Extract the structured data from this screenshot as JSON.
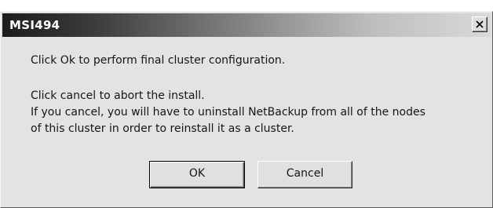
{
  "window": {
    "title": "MSI494",
    "close_icon": "close-x-icon"
  },
  "message": {
    "line1": "Click Ok to perform final cluster configuration.",
    "line2": "Click cancel to abort the install.",
    "line3": "If you cancel, you will have to uninstall NetBackup from all of the nodes",
    "line4": "of this cluster in order to reinstall it as a cluster."
  },
  "buttons": {
    "ok_label": "OK",
    "cancel_label": "Cancel"
  },
  "colors": {
    "dialog_background": "#e3e3e3",
    "titlebar_dark": "#1c1c1c",
    "titlebar_light": "#d9d9d9",
    "title_text": "#ffffff",
    "body_text": "#151515"
  }
}
